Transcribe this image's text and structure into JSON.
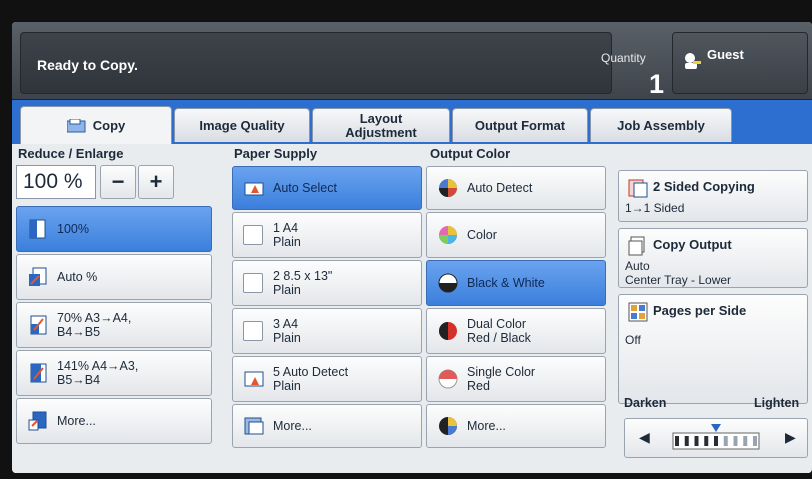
{
  "status": {
    "message": "Ready to Copy."
  },
  "quantity": {
    "label": "Quantity",
    "value": "1"
  },
  "user": {
    "label": "Guest",
    "icon": "user-key-icon"
  },
  "tabs": [
    {
      "label": "Copy",
      "active": true,
      "icon": "copy-tab-icon"
    },
    {
      "label": "Image Quality",
      "active": false
    },
    {
      "label": "Layout Adjustment",
      "active": false
    },
    {
      "label": "Output Format",
      "active": false
    },
    {
      "label": "Job Assembly",
      "active": false
    }
  ],
  "reduce_enlarge": {
    "label": "Reduce / Enlarge",
    "current": "100 %",
    "minus": "−",
    "plus": "+",
    "options": [
      {
        "label": "100%",
        "selected": true
      },
      {
        "label": "Auto %",
        "selected": false
      },
      {
        "label": "70% A3→A4,",
        "label2": "B4→B5",
        "selected": false
      },
      {
        "label": "141% A4→A3,",
        "label2": "B5→B4",
        "selected": false
      },
      {
        "label": "More...",
        "selected": false
      }
    ]
  },
  "paper_supply": {
    "label": "Paper Supply",
    "options": [
      {
        "label": "Auto Select",
        "selected": true
      },
      {
        "line1": "1 A4",
        "line2": "Plain"
      },
      {
        "line1": "2 8.5 x 13\"",
        "line2": "Plain"
      },
      {
        "line1": "3 A4",
        "line2": "Plain"
      },
      {
        "line1": "5 Auto Detect",
        "line2": "Plain"
      },
      {
        "label": "More..."
      }
    ]
  },
  "output_color": {
    "label": "Output Color",
    "options": [
      {
        "label": "Auto Detect",
        "selected": false
      },
      {
        "label": "Color",
        "selected": false
      },
      {
        "label": "Black & White",
        "selected": true
      },
      {
        "label": "Dual Color",
        "label2": "Red / Black",
        "selected": false
      },
      {
        "label": "Single Color",
        "label2": "Red",
        "selected": false
      },
      {
        "label": "More...",
        "selected": false
      }
    ]
  },
  "right_panel": {
    "two_sided": {
      "title": "2 Sided Copying",
      "value": "1→1 Sided"
    },
    "copy_output": {
      "title": "Copy Output",
      "value1": "Auto",
      "value2": "Center Tray - Lower"
    },
    "pages_per_side": {
      "title": "Pages per Side",
      "value": "Off"
    },
    "darkness": {
      "left": "Darken",
      "right": "Lighten",
      "level": 0.5
    }
  },
  "colors": {
    "tab_blue": "#2d6fd0",
    "selected_blue": "#3b7fdc",
    "topbar": "#3e444b"
  }
}
